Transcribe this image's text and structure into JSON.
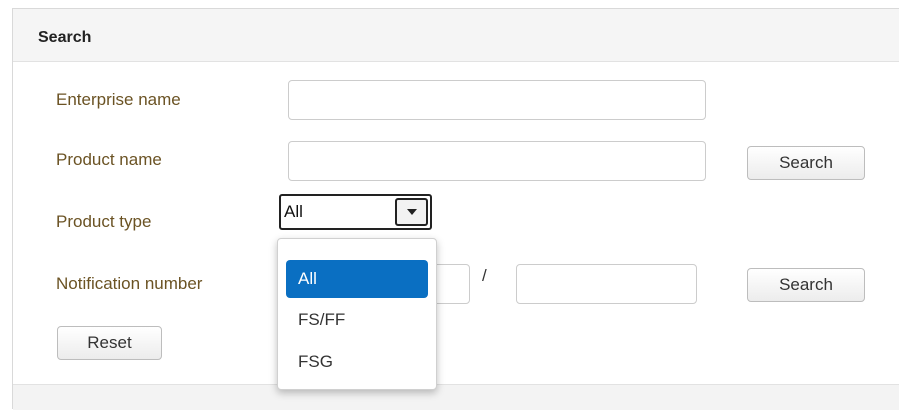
{
  "panel": {
    "title": "Search"
  },
  "form": {
    "enterprise_label": "Enterprise name",
    "enterprise_value": "",
    "product_name_label": "Product name",
    "product_name_value": "",
    "product_search_button": "Search",
    "product_type_label": "Product type",
    "product_type_value": "All",
    "notification_label": "Notification number",
    "notification_part1": "",
    "notification_separator": "/",
    "notification_part2": "",
    "notification_search_button": "Search",
    "reset_button": "Reset"
  },
  "dropdown": {
    "options": [
      {
        "label": "All",
        "selected": true
      },
      {
        "label": "FS/FF",
        "selected": false
      },
      {
        "label": "FSG",
        "selected": false
      }
    ]
  },
  "colors": {
    "label_text": "#6b5324",
    "selected_option_bg": "#0a6fc2",
    "header_bg": "#f5f5f5"
  },
  "icons": {
    "select_arrow": "triangle-down-icon"
  }
}
